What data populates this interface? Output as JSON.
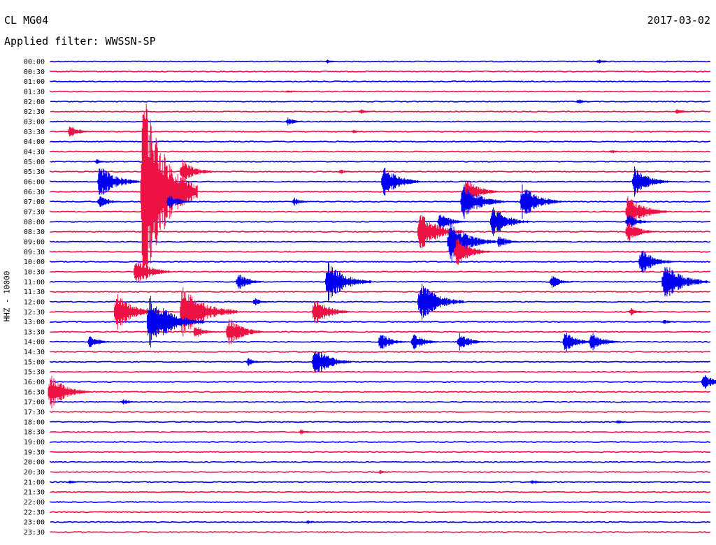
{
  "header": {
    "station": "CL MG04",
    "date": "2017-03-02",
    "filter": "Applied filter: WWSSN-SP"
  },
  "chart_data": {
    "type": "line",
    "ylabel": "HHZ - 10000",
    "tick_labels": [
      "00:00",
      "00:30",
      "01:00",
      "01:30",
      "02:00",
      "02:30",
      "03:00",
      "03:30",
      "04:00",
      "04:30",
      "05:00",
      "05:30",
      "06:00",
      "06:30",
      "07:00",
      "07:30",
      "08:00",
      "08:30",
      "09:00",
      "09:30",
      "10:00",
      "10:30",
      "11:00",
      "11:30",
      "12:00",
      "12:30",
      "13:00",
      "13:30",
      "14:00",
      "14:30",
      "15:00",
      "15:30",
      "16:00",
      "16:30",
      "17:00",
      "17:30",
      "18:00",
      "18:30",
      "19:00",
      "19:30",
      "20:00",
      "20:30",
      "21:00",
      "21:30",
      "22:00",
      "22:30",
      "23:00",
      "23:30"
    ],
    "trace_colors": [
      "#0000ee",
      "#ee1144"
    ],
    "events": [
      {
        "row": 0,
        "x": 0.42,
        "amp": 3
      },
      {
        "row": 0,
        "x": 0.83,
        "amp": 4
      },
      {
        "row": 2,
        "x": 0.03,
        "amp": 2
      },
      {
        "row": 3,
        "x": 0.36,
        "amp": 3
      },
      {
        "row": 4,
        "x": 0.8,
        "amp": 4
      },
      {
        "row": 5,
        "x": 0.47,
        "amp": 4
      },
      {
        "row": 5,
        "x": 0.95,
        "amp": 5
      },
      {
        "row": 6,
        "x": 0.36,
        "amp": 6
      },
      {
        "row": 7,
        "x": 0.03,
        "amp": 10
      },
      {
        "row": 7,
        "x": 0.46,
        "amp": 3
      },
      {
        "row": 9,
        "x": 0.85,
        "amp": 3
      },
      {
        "row": 10,
        "x": 0.07,
        "amp": 4
      },
      {
        "row": 11,
        "x": 0.2,
        "amp": 18
      },
      {
        "row": 11,
        "x": 0.44,
        "amp": 4
      },
      {
        "row": 12,
        "x": 0.075,
        "amp": 26
      },
      {
        "row": 12,
        "x": 0.505,
        "amp": 24
      },
      {
        "row": 12,
        "x": 0.885,
        "amp": 22
      },
      {
        "row": 13,
        "x": 0.14,
        "amp": 160
      },
      {
        "row": 13,
        "x": 0.63,
        "amp": 20
      },
      {
        "row": 14,
        "x": 0.075,
        "amp": 10
      },
      {
        "row": 14,
        "x": 0.18,
        "amp": 12
      },
      {
        "row": 14,
        "x": 0.37,
        "amp": 6
      },
      {
        "row": 14,
        "x": 0.625,
        "amp": 28
      },
      {
        "row": 14,
        "x": 0.715,
        "amp": 26
      },
      {
        "row": 15,
        "x": 0.875,
        "amp": 26
      },
      {
        "row": 16,
        "x": 0.67,
        "amp": 24
      },
      {
        "row": 16,
        "x": 0.59,
        "amp": 14
      },
      {
        "row": 16,
        "x": 0.875,
        "amp": 12
      },
      {
        "row": 17,
        "x": 0.56,
        "amp": 30
      },
      {
        "row": 17,
        "x": 0.875,
        "amp": 16
      },
      {
        "row": 18,
        "x": 0.605,
        "amp": 32
      },
      {
        "row": 18,
        "x": 0.68,
        "amp": 10
      },
      {
        "row": 19,
        "x": 0.615,
        "amp": 22
      },
      {
        "row": 20,
        "x": 0.895,
        "amp": 20
      },
      {
        "row": 21,
        "x": 0.13,
        "amp": 22
      },
      {
        "row": 22,
        "x": 0.285,
        "amp": 14
      },
      {
        "row": 22,
        "x": 0.42,
        "amp": 30
      },
      {
        "row": 22,
        "x": 0.76,
        "amp": 10
      },
      {
        "row": 22,
        "x": 0.93,
        "amp": 30
      },
      {
        "row": 24,
        "x": 0.56,
        "amp": 30
      },
      {
        "row": 24,
        "x": 0.31,
        "amp": 6
      },
      {
        "row": 25,
        "x": 0.1,
        "amp": 28
      },
      {
        "row": 25,
        "x": 0.2,
        "amp": 40
      },
      {
        "row": 25,
        "x": 0.4,
        "amp": 22
      },
      {
        "row": 25,
        "x": 0.88,
        "amp": 6
      },
      {
        "row": 26,
        "x": 0.15,
        "amp": 40
      },
      {
        "row": 26,
        "x": 0.93,
        "amp": 4
      },
      {
        "row": 27,
        "x": 0.27,
        "amp": 22
      },
      {
        "row": 27,
        "x": 0.22,
        "amp": 10
      },
      {
        "row": 28,
        "x": 0.06,
        "amp": 10
      },
      {
        "row": 28,
        "x": 0.5,
        "amp": 14
      },
      {
        "row": 28,
        "x": 0.55,
        "amp": 14
      },
      {
        "row": 28,
        "x": 0.62,
        "amp": 14
      },
      {
        "row": 28,
        "x": 0.78,
        "amp": 16
      },
      {
        "row": 28,
        "x": 0.82,
        "amp": 16
      },
      {
        "row": 30,
        "x": 0.4,
        "amp": 24
      },
      {
        "row": 30,
        "x": 0.3,
        "amp": 6
      },
      {
        "row": 32,
        "x": 0.99,
        "amp": 12
      },
      {
        "row": 33,
        "x": 0.0,
        "amp": 26
      },
      {
        "row": 34,
        "x": 0.11,
        "amp": 5
      },
      {
        "row": 36,
        "x": 0.86,
        "amp": 3
      },
      {
        "row": 37,
        "x": 0.38,
        "amp": 4
      },
      {
        "row": 41,
        "x": 0.5,
        "amp": 3
      },
      {
        "row": 42,
        "x": 0.03,
        "amp": 3
      },
      {
        "row": 42,
        "x": 0.73,
        "amp": 4
      },
      {
        "row": 46,
        "x": 0.39,
        "amp": 3
      }
    ]
  }
}
